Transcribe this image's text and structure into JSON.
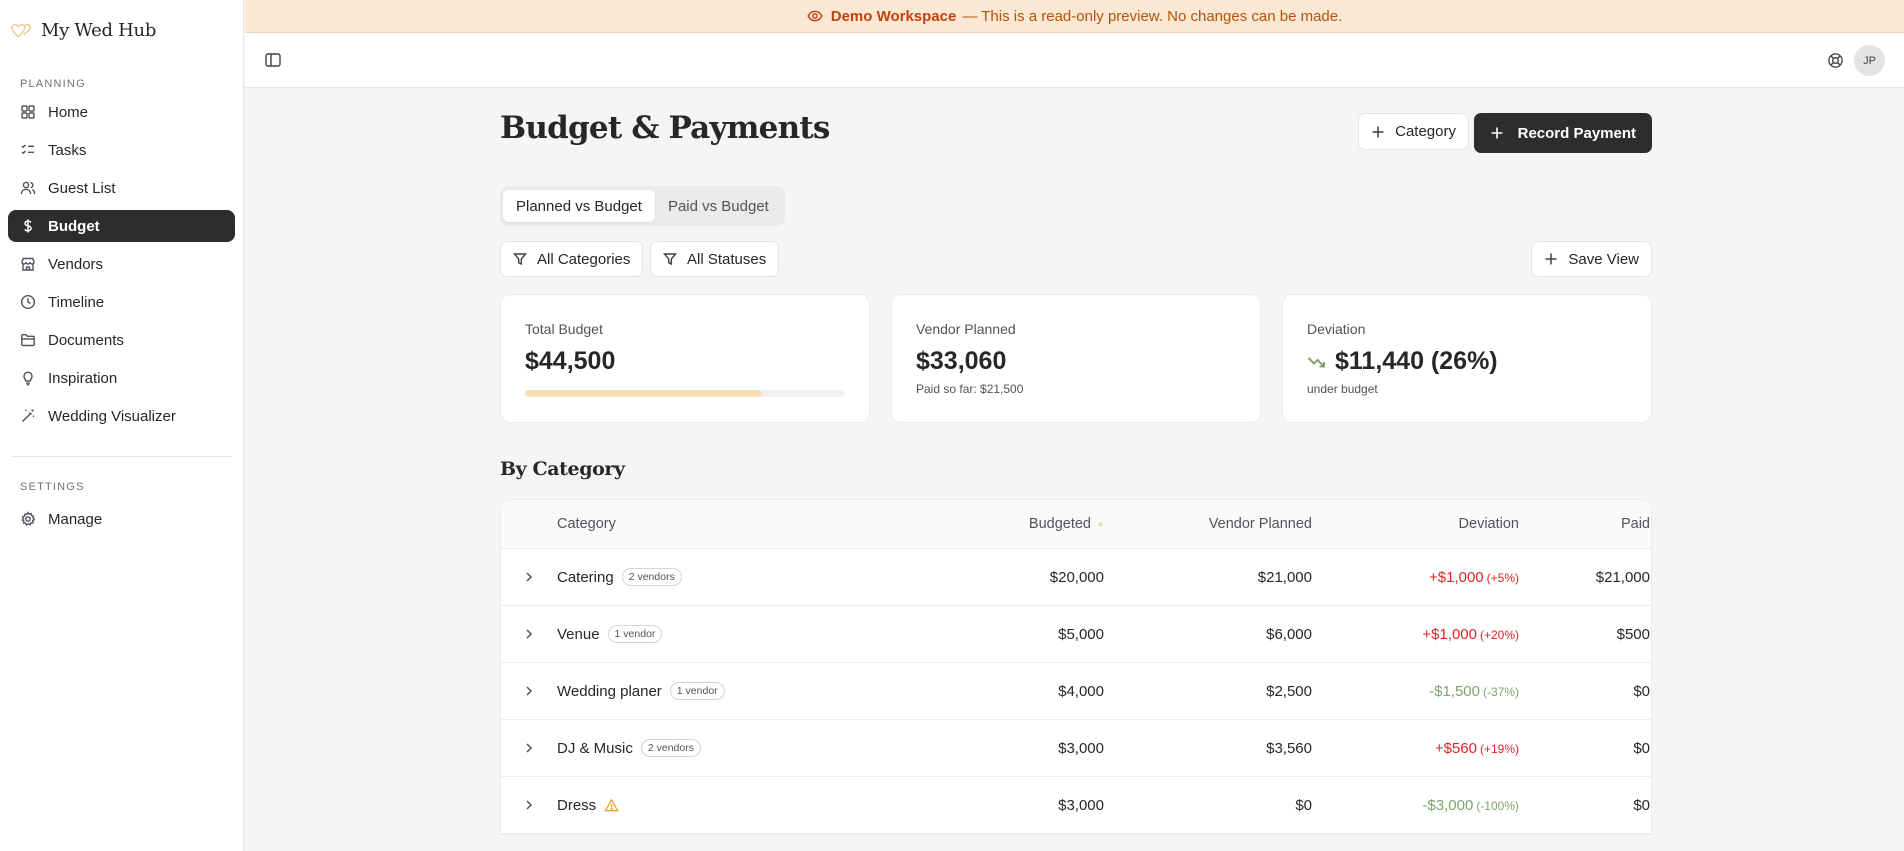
{
  "app": {
    "name": "My Wed Hub"
  },
  "sidebar": {
    "planning_label": "PLANNING",
    "items": [
      {
        "label": "Home",
        "icon": "grid-icon"
      },
      {
        "label": "Tasks",
        "icon": "list-check-icon"
      },
      {
        "label": "Guest List",
        "icon": "users-icon"
      },
      {
        "label": "Budget",
        "icon": "dollar-icon",
        "active": true
      },
      {
        "label": "Vendors",
        "icon": "store-icon"
      },
      {
        "label": "Timeline",
        "icon": "clock-icon"
      },
      {
        "label": "Documents",
        "icon": "folder-icon"
      },
      {
        "label": "Inspiration",
        "icon": "lightbulb-icon"
      },
      {
        "label": "Wedding Visualizer",
        "icon": "wand-icon"
      }
    ],
    "settings_label": "SETTINGS",
    "settings_items": [
      {
        "label": "Manage",
        "icon": "gear-icon"
      }
    ]
  },
  "banner": {
    "title": "Demo Workspace",
    "message": "— This is a read-only preview. No changes can be made."
  },
  "topbar": {
    "avatar_initials": "JP"
  },
  "page": {
    "title": "Budget & Payments",
    "category_button": "Category",
    "record_payment_button": "Record Payment",
    "tabs": [
      "Planned vs Budget",
      "Paid vs Budget"
    ],
    "active_tab": 0,
    "filter_categories": "All Categories",
    "filter_statuses": "All Statuses",
    "save_view": "Save View"
  },
  "cards": {
    "total_budget": {
      "label": "Total Budget",
      "value": "$44,500",
      "progress_fraction": 0.74
    },
    "vendor_planned": {
      "label": "Vendor Planned",
      "value": "$33,060",
      "sub": "Paid so far: $21,500"
    },
    "deviation": {
      "label": "Deviation",
      "value": "$11,440 (26%)",
      "sub": "under budget"
    }
  },
  "by_category": {
    "title": "By Category",
    "columns": [
      "Category",
      "Budgeted",
      "Vendor Planned",
      "Deviation",
      "Paid"
    ],
    "rows": [
      {
        "category": "Catering",
        "badge": "2 vendors",
        "budgeted": "$20,000",
        "vendor_planned": "$21,000",
        "deviation": "+$1,000",
        "deviation_pct": "(+5%)",
        "status": "over",
        "paid": "$21,000"
      },
      {
        "category": "Venue",
        "badge": "1 vendor",
        "budgeted": "$5,000",
        "vendor_planned": "$6,000",
        "deviation": "+$1,000",
        "deviation_pct": "(+20%)",
        "status": "over",
        "paid": "$500"
      },
      {
        "category": "Wedding planer",
        "badge": "1 vendor",
        "budgeted": "$4,000",
        "vendor_planned": "$2,500",
        "deviation": "-$1,500",
        "deviation_pct": "(-37%)",
        "status": "under",
        "paid": "$0"
      },
      {
        "category": "DJ & Music",
        "badge": "2 vendors",
        "budgeted": "$3,000",
        "vendor_planned": "$3,560",
        "deviation": "+$560",
        "deviation_pct": "(+19%)",
        "status": "over",
        "paid": "$0"
      },
      {
        "category": "Dress",
        "badge": "",
        "warning": true,
        "budgeted": "$3,000",
        "vendor_planned": "$0",
        "deviation": "-$3,000",
        "deviation_pct": "(-100%)",
        "status": "under",
        "paid": "$0"
      }
    ]
  },
  "colors": {
    "accent_dark": "#2d2d2d",
    "banner_bg": "#fbe8d4",
    "banner_text": "#c2410c",
    "over": "#dc2626",
    "under": "#7fa36a",
    "progress": "#f6dfb5"
  }
}
